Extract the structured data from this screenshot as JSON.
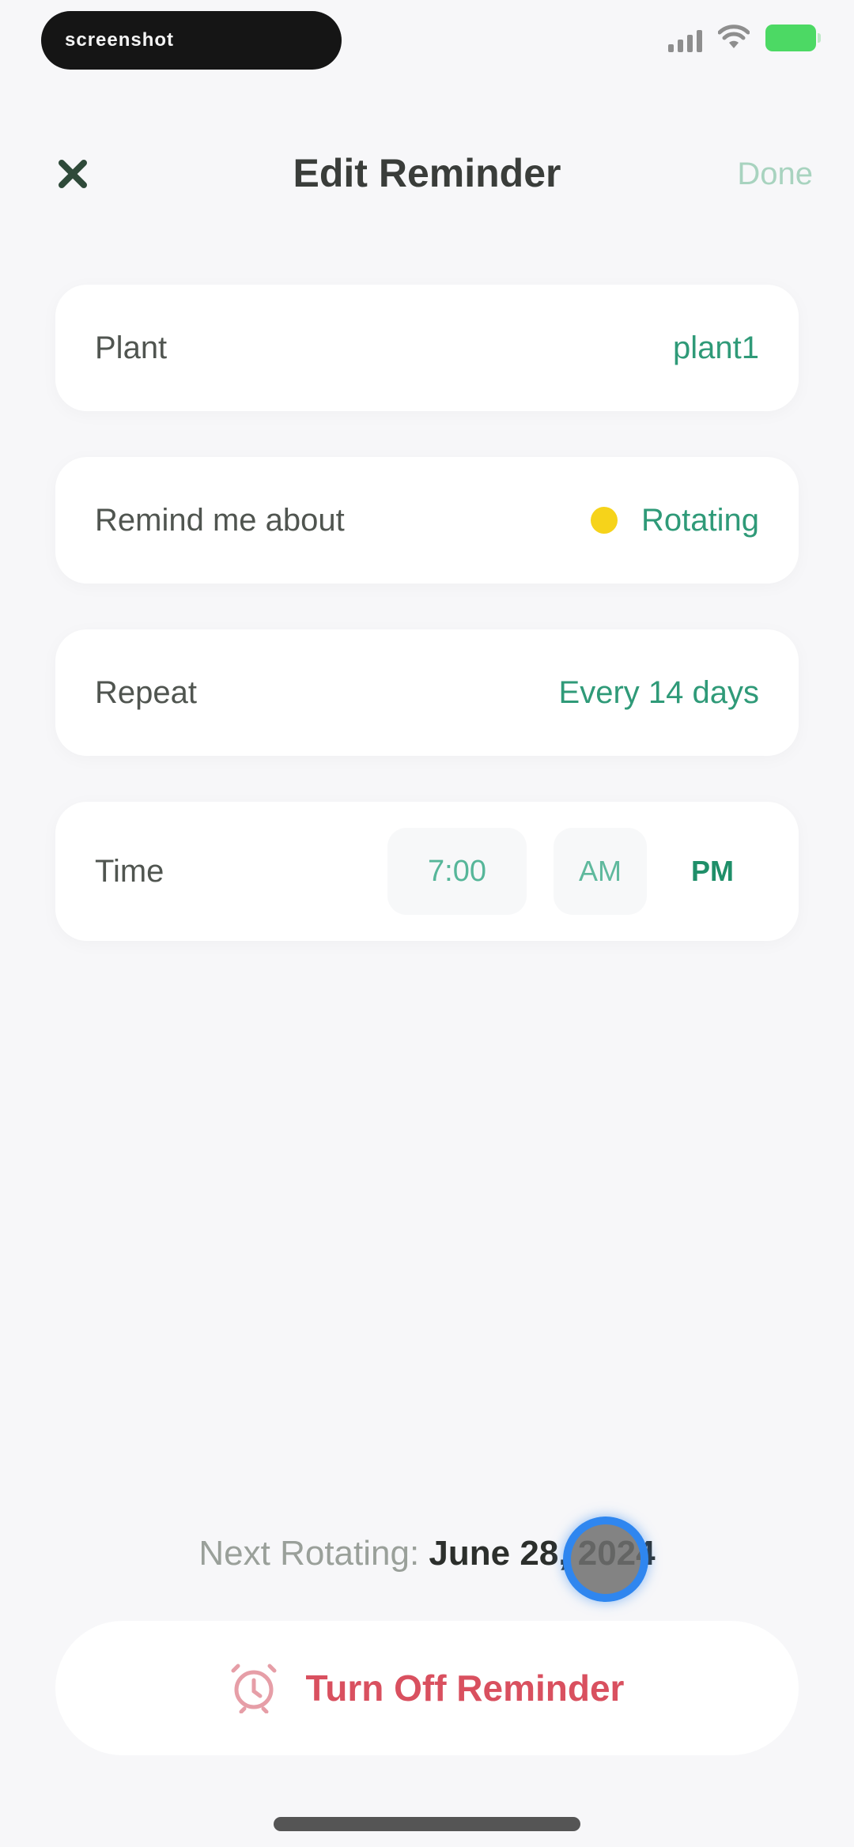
{
  "status_bar": {
    "recording_label": "screenshot",
    "recording_sub": "",
    "battery_color": "#4cd964"
  },
  "header": {
    "close_icon": "close-icon",
    "title": "Edit Reminder",
    "done_label": "Done"
  },
  "settings": {
    "plant": {
      "label": "Plant",
      "value": "plant1"
    },
    "remind": {
      "label": "Remind me about",
      "value": "Rotating",
      "icon": "rotate-dot-icon",
      "icon_color": "#f6d31a"
    },
    "repeat": {
      "label": "Repeat",
      "value": "Every 14 days"
    },
    "time": {
      "label": "Time",
      "value": "7:00",
      "am_label": "AM",
      "pm_label": "PM",
      "selected": "PM"
    }
  },
  "next_event": {
    "label": "Next Rotating:",
    "date": "June 28, 2024"
  },
  "turn_off": {
    "label": "Turn Off Reminder",
    "icon": "alarm-off-icon",
    "color": "#d9505f"
  },
  "colors": {
    "accent": "#2f9a78",
    "background": "#f7f7f9",
    "card": "#ffffff"
  }
}
